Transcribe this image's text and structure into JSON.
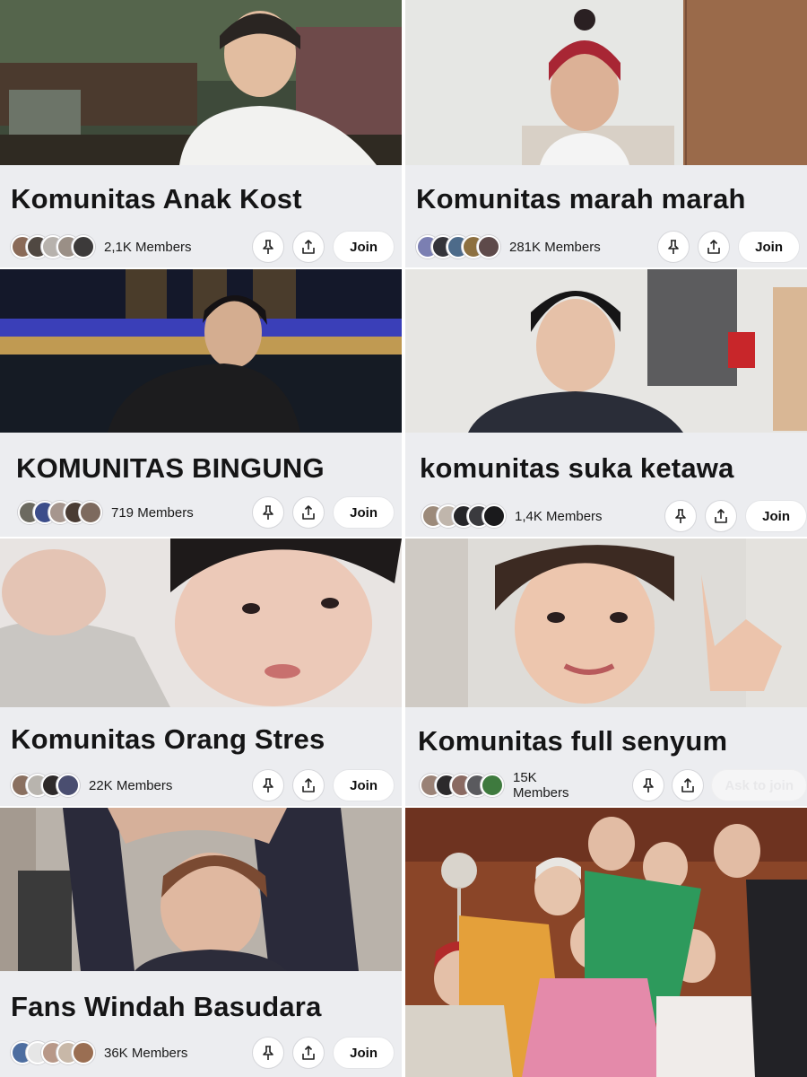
{
  "communities": [
    {
      "title": "Komunitas Anak Kost",
      "members": "2,1K Members",
      "action": "Join"
    },
    {
      "title": "Komunitas marah marah",
      "members": "281K Members",
      "action": "Join"
    },
    {
      "title": "KOMUNITAS BINGUNG",
      "members": "719 Members",
      "action": "Join"
    },
    {
      "title": "komunitas suka ketawa",
      "members": "1,4K Members",
      "action": "Join"
    },
    {
      "title": "Komunitas Orang Stres",
      "members": "22K Members",
      "action": "Join"
    },
    {
      "title": "Komunitas full senyum",
      "members": "15K Members",
      "action": "Ask to join"
    },
    {
      "title": "Fans Windah Basudara",
      "members": "36K Members",
      "action": "Join"
    }
  ],
  "icons": {
    "pin": "pin-icon",
    "share": "share-icon"
  },
  "colors": {
    "card_bg": "#ecedf0",
    "button_bg": "#ffffff",
    "text": "#151516"
  }
}
